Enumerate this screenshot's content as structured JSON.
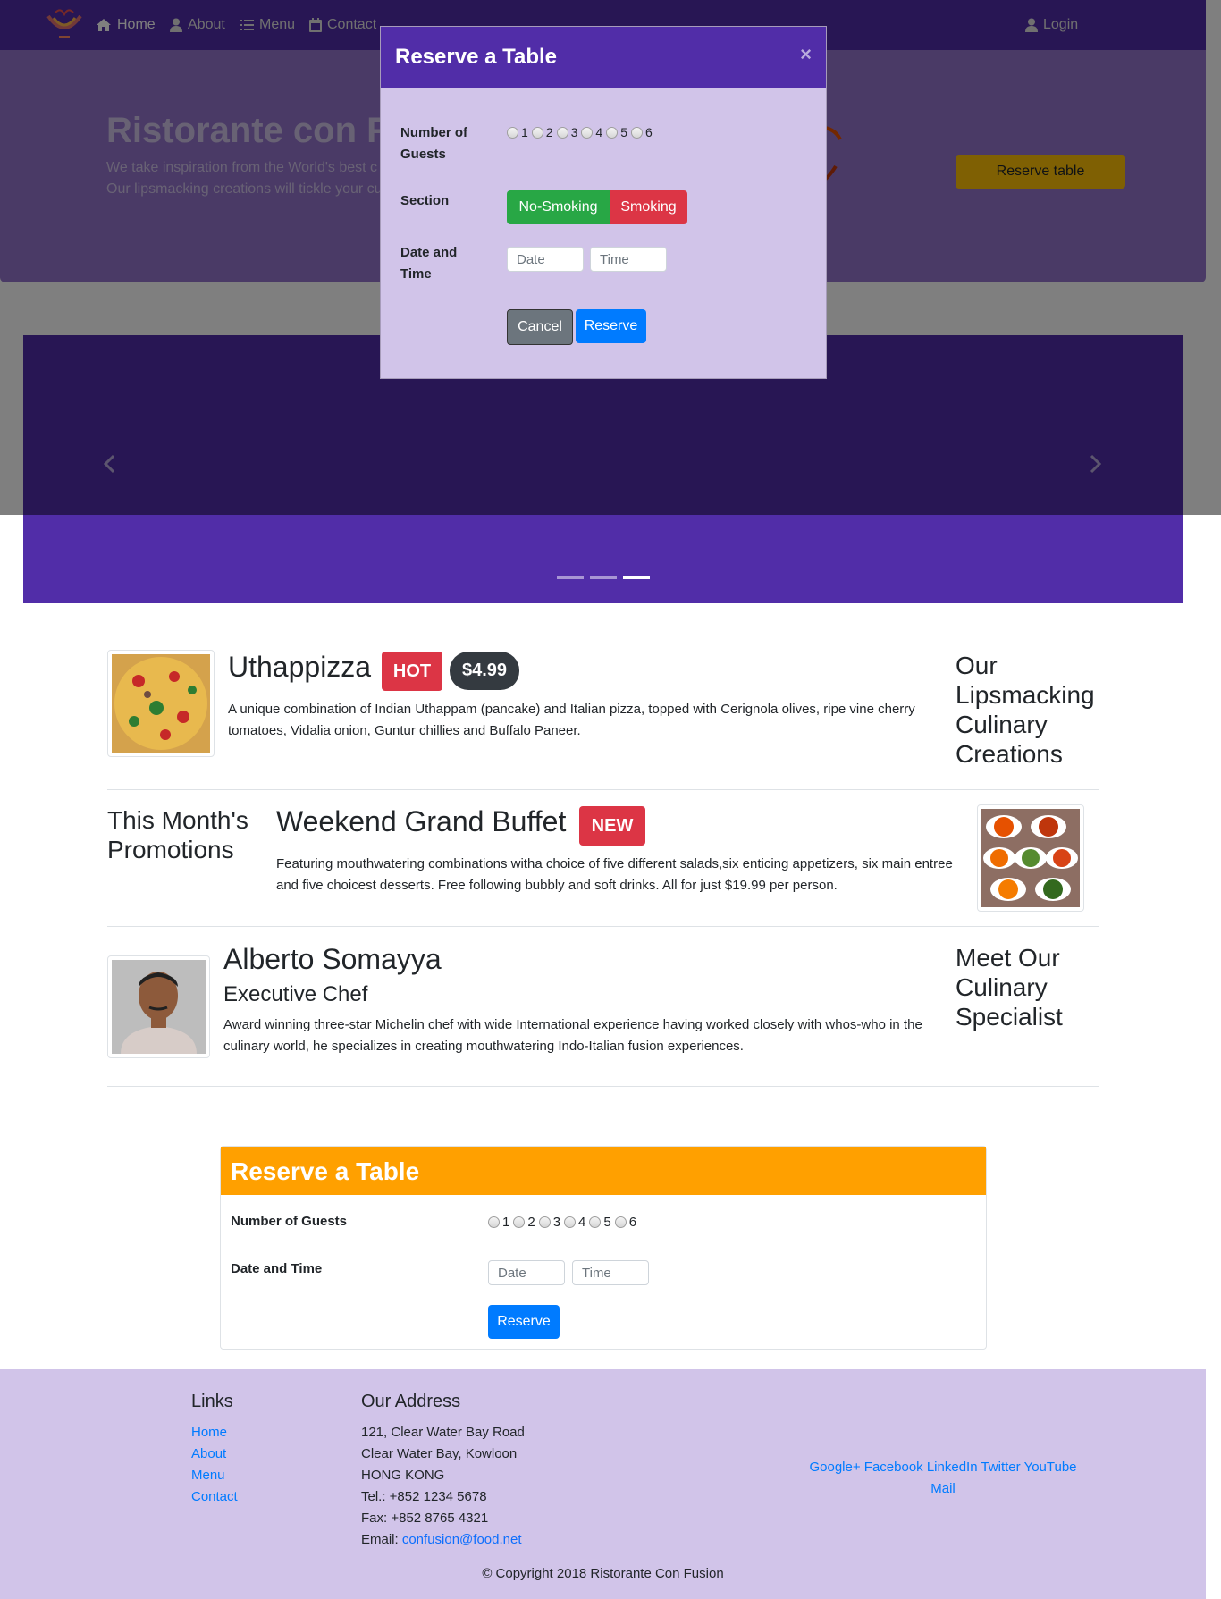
{
  "navbar": {
    "brand_icon": "restaurant-logo",
    "items": [
      {
        "label": "Home",
        "icon": "home-icon"
      },
      {
        "label": "About",
        "icon": "user-icon"
      },
      {
        "label": "Menu",
        "icon": "list-icon"
      },
      {
        "label": "Contact",
        "icon": "address-card-icon"
      }
    ],
    "login_label": "Login",
    "login_icon": "user-icon",
    "bg_color": "#512da8"
  },
  "jumbotron": {
    "title": "Ristorante con Fu",
    "text_line1": "We take inspiration from the World's best c",
    "text_line2": "Our lipsmacking creations will tickle your cu",
    "button_label": "Reserve table"
  },
  "carousel": {
    "prev_icon": "chevron-left-icon",
    "next_icon": "chevron-right-icon",
    "indicator_count": 3,
    "active_indicator": 3
  },
  "modal": {
    "title": "Reserve a Table",
    "close_label": "×",
    "guests_label_line1": "Number of",
    "guests_label_line2": "Guests",
    "guest_options": [
      "1",
      "2",
      "3",
      "4",
      "5",
      "6"
    ],
    "section_label": "Section",
    "section_options": [
      "No-Smoking",
      "Smoking"
    ],
    "datetime_label_line1": "Date and",
    "datetime_label_line2": "Time",
    "date_placeholder": "Date",
    "time_placeholder": "Time",
    "cancel_label": "Cancel",
    "reserve_label": "Reserve"
  },
  "dish": {
    "name": "Uthappizza",
    "badge": "HOT",
    "price": "$4.99",
    "description": "A unique combination of Indian Uthappam (pancake) and Italian pizza, topped with Cerignola olives, ripe vine cherry tomatoes, Vidalia onion, Guntur chillies and Buffalo Paneer.",
    "side_heading": "Our Lipsmacking Culinary Creations"
  },
  "promotion": {
    "side_heading": "This Month's Promotions",
    "name": "Weekend Grand Buffet",
    "badge": "NEW",
    "description": "Featuring mouthwatering combinations witha choice of five different salads,six enticing appetizers, six main entree and five choicest desserts. Free following bubbly and soft drinks. All for just $19.99 per person."
  },
  "leader": {
    "name": "Alberto Somayya",
    "designation": "Executive Chef",
    "description": "Award winning three-star Michelin chef with wide International experience having worked closely with whos-who in the culinary world, he specializes in creating mouthwatering Indo-Italian fusion experiences.",
    "side_heading": "Meet Our Culinary Specialist"
  },
  "reserve_card": {
    "title": "Reserve a Table",
    "guests_label": "Number of Guests",
    "guest_options": [
      "1",
      "2",
      "3",
      "4",
      "5",
      "6"
    ],
    "datetime_label": "Date and Time",
    "date_placeholder": "Date",
    "time_placeholder": "Time",
    "reserve_label": "Reserve"
  },
  "footer": {
    "links_heading": "Links",
    "links": [
      "Home",
      "About",
      "Menu",
      "Contact"
    ],
    "address_heading": "Our Address",
    "address_lines": [
      "121, Clear Water Bay Road",
      "Clear Water Bay, Kowloon",
      "HONG KONG",
      "Tel.: +852 1234 5678",
      "Fax: +852 8765 4321"
    ],
    "email_prefix": "Email: ",
    "email": "confusion@food.net",
    "social": [
      "Google+",
      "Facebook",
      "LinkedIn",
      "Twitter",
      "YouTube",
      "Mail"
    ],
    "copyright": "© Copyright 2018 Ristorante Con Fusion"
  }
}
